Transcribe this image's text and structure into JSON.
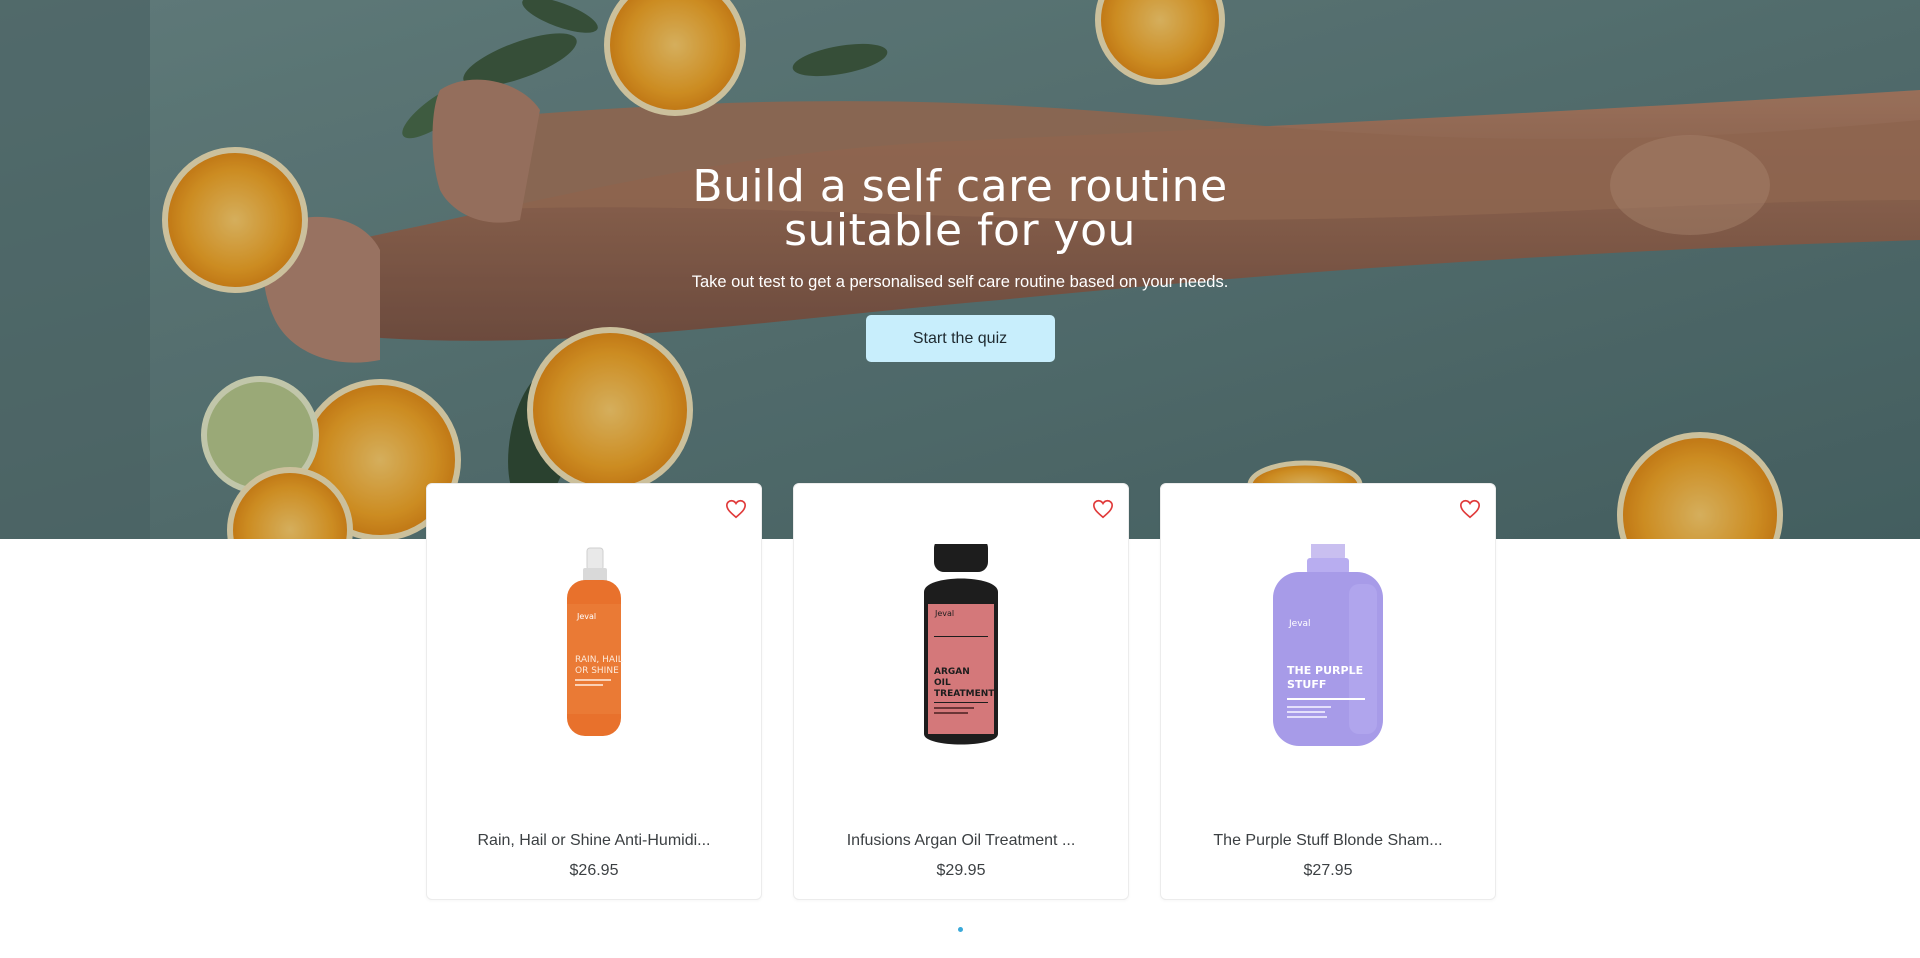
{
  "hero": {
    "title_line1": "Build a self care routine",
    "title_line2": "suitable for you",
    "subtitle": "Take out test to get a personalised self care routine based on your needs.",
    "cta_label": "Start the quiz",
    "background_description_icon": "bath-legs-oranges-image"
  },
  "products": [
    {
      "name": "Rain, Hail or Shine Anti-Humidi...",
      "price": "$26.95",
      "bottle_brand": "Jeval",
      "bottle_label": "RAIN, HAIL OR SHINE",
      "bottle_color": "#e8712c",
      "wishlist_icon": "heart-icon"
    },
    {
      "name": "Infusions Argan Oil Treatment ...",
      "price": "$29.95",
      "bottle_brand": "Jeval",
      "bottle_label": "ARGAN OIL TREATMENT",
      "bottle_color": "#d4787a",
      "wishlist_icon": "heart-icon"
    },
    {
      "name": "The Purple Stuff Blonde Sham...",
      "price": "$27.95",
      "bottle_brand": "Jeval",
      "bottle_label": "THE PURPLE STUFF",
      "bottle_color": "#a79be8",
      "wishlist_icon": "heart-icon"
    }
  ],
  "carousel": {
    "active_page": 1
  },
  "colors": {
    "cta_background": "#c8eefc",
    "heart": "#e03a3a",
    "pager_dot": "#3aa9d9"
  }
}
